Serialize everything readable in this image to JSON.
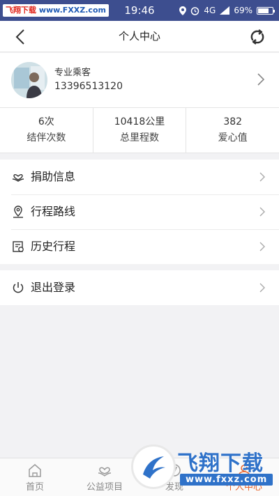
{
  "status_bar": {
    "watermark_cn": "飞翔下载",
    "watermark_url": "www.FXXZ.com",
    "time": "19:46",
    "network": "4G",
    "battery": "69%"
  },
  "nav": {
    "title": "个人中心",
    "back_icon": "chevron-left-icon",
    "refresh_icon": "refresh-icon"
  },
  "profile": {
    "role": "专业乘客",
    "phone": "13396513120"
  },
  "stats": [
    {
      "value": "6次",
      "label": "结伴次数"
    },
    {
      "value": "10418公里",
      "label": "总里程数"
    },
    {
      "value": "382",
      "label": "爱心值"
    }
  ],
  "menu": [
    {
      "label": "捐助信息",
      "icon": "donation-icon"
    },
    {
      "label": "行程路线",
      "icon": "location-pin-icon"
    },
    {
      "label": "历史行程",
      "icon": "history-icon"
    }
  ],
  "logout": {
    "label": "退出登录",
    "icon": "power-icon"
  },
  "tabs": [
    {
      "label": "首页",
      "icon": "home-icon",
      "active": false
    },
    {
      "label": "公益项目",
      "icon": "charity-icon",
      "active": false
    },
    {
      "label": "发现",
      "icon": "discover-icon",
      "active": false
    },
    {
      "label": "个人中心",
      "icon": "user-icon",
      "active": true
    }
  ],
  "watermark_bottom": {
    "brand": "飞翔下载",
    "url": "www.fxxz.com"
  },
  "colors": {
    "status_bar": "#3d4e8f",
    "accent": "#e8632a",
    "watermark_blue": "#2f72c9"
  }
}
